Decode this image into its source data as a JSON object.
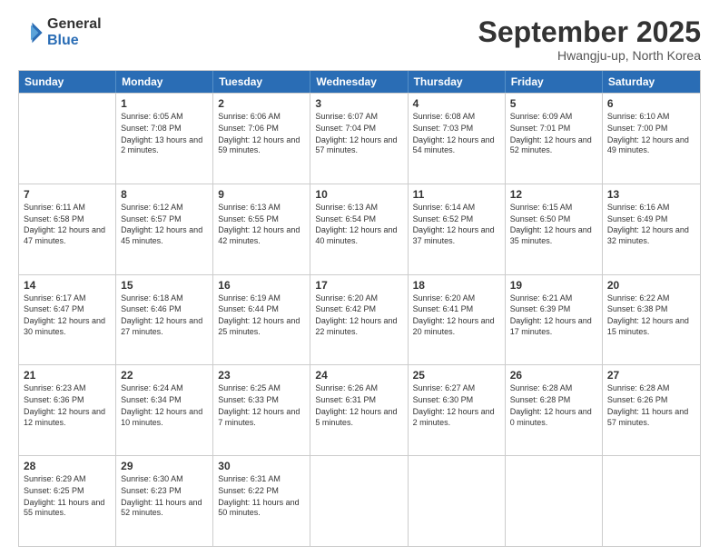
{
  "logo": {
    "general": "General",
    "blue": "Blue"
  },
  "title": "September 2025",
  "location": "Hwangju-up, North Korea",
  "header_days": [
    "Sunday",
    "Monday",
    "Tuesday",
    "Wednesday",
    "Thursday",
    "Friday",
    "Saturday"
  ],
  "rows": [
    [
      {
        "day": "",
        "sunrise": "",
        "sunset": "",
        "daylight": ""
      },
      {
        "day": "1",
        "sunrise": "Sunrise: 6:05 AM",
        "sunset": "Sunset: 7:08 PM",
        "daylight": "Daylight: 13 hours and 2 minutes."
      },
      {
        "day": "2",
        "sunrise": "Sunrise: 6:06 AM",
        "sunset": "Sunset: 7:06 PM",
        "daylight": "Daylight: 12 hours and 59 minutes."
      },
      {
        "day": "3",
        "sunrise": "Sunrise: 6:07 AM",
        "sunset": "Sunset: 7:04 PM",
        "daylight": "Daylight: 12 hours and 57 minutes."
      },
      {
        "day": "4",
        "sunrise": "Sunrise: 6:08 AM",
        "sunset": "Sunset: 7:03 PM",
        "daylight": "Daylight: 12 hours and 54 minutes."
      },
      {
        "day": "5",
        "sunrise": "Sunrise: 6:09 AM",
        "sunset": "Sunset: 7:01 PM",
        "daylight": "Daylight: 12 hours and 52 minutes."
      },
      {
        "day": "6",
        "sunrise": "Sunrise: 6:10 AM",
        "sunset": "Sunset: 7:00 PM",
        "daylight": "Daylight: 12 hours and 49 minutes."
      }
    ],
    [
      {
        "day": "7",
        "sunrise": "Sunrise: 6:11 AM",
        "sunset": "Sunset: 6:58 PM",
        "daylight": "Daylight: 12 hours and 47 minutes."
      },
      {
        "day": "8",
        "sunrise": "Sunrise: 6:12 AM",
        "sunset": "Sunset: 6:57 PM",
        "daylight": "Daylight: 12 hours and 45 minutes."
      },
      {
        "day": "9",
        "sunrise": "Sunrise: 6:13 AM",
        "sunset": "Sunset: 6:55 PM",
        "daylight": "Daylight: 12 hours and 42 minutes."
      },
      {
        "day": "10",
        "sunrise": "Sunrise: 6:13 AM",
        "sunset": "Sunset: 6:54 PM",
        "daylight": "Daylight: 12 hours and 40 minutes."
      },
      {
        "day": "11",
        "sunrise": "Sunrise: 6:14 AM",
        "sunset": "Sunset: 6:52 PM",
        "daylight": "Daylight: 12 hours and 37 minutes."
      },
      {
        "day": "12",
        "sunrise": "Sunrise: 6:15 AM",
        "sunset": "Sunset: 6:50 PM",
        "daylight": "Daylight: 12 hours and 35 minutes."
      },
      {
        "day": "13",
        "sunrise": "Sunrise: 6:16 AM",
        "sunset": "Sunset: 6:49 PM",
        "daylight": "Daylight: 12 hours and 32 minutes."
      }
    ],
    [
      {
        "day": "14",
        "sunrise": "Sunrise: 6:17 AM",
        "sunset": "Sunset: 6:47 PM",
        "daylight": "Daylight: 12 hours and 30 minutes."
      },
      {
        "day": "15",
        "sunrise": "Sunrise: 6:18 AM",
        "sunset": "Sunset: 6:46 PM",
        "daylight": "Daylight: 12 hours and 27 minutes."
      },
      {
        "day": "16",
        "sunrise": "Sunrise: 6:19 AM",
        "sunset": "Sunset: 6:44 PM",
        "daylight": "Daylight: 12 hours and 25 minutes."
      },
      {
        "day": "17",
        "sunrise": "Sunrise: 6:20 AM",
        "sunset": "Sunset: 6:42 PM",
        "daylight": "Daylight: 12 hours and 22 minutes."
      },
      {
        "day": "18",
        "sunrise": "Sunrise: 6:20 AM",
        "sunset": "Sunset: 6:41 PM",
        "daylight": "Daylight: 12 hours and 20 minutes."
      },
      {
        "day": "19",
        "sunrise": "Sunrise: 6:21 AM",
        "sunset": "Sunset: 6:39 PM",
        "daylight": "Daylight: 12 hours and 17 minutes."
      },
      {
        "day": "20",
        "sunrise": "Sunrise: 6:22 AM",
        "sunset": "Sunset: 6:38 PM",
        "daylight": "Daylight: 12 hours and 15 minutes."
      }
    ],
    [
      {
        "day": "21",
        "sunrise": "Sunrise: 6:23 AM",
        "sunset": "Sunset: 6:36 PM",
        "daylight": "Daylight: 12 hours and 12 minutes."
      },
      {
        "day": "22",
        "sunrise": "Sunrise: 6:24 AM",
        "sunset": "Sunset: 6:34 PM",
        "daylight": "Daylight: 12 hours and 10 minutes."
      },
      {
        "day": "23",
        "sunrise": "Sunrise: 6:25 AM",
        "sunset": "Sunset: 6:33 PM",
        "daylight": "Daylight: 12 hours and 7 minutes."
      },
      {
        "day": "24",
        "sunrise": "Sunrise: 6:26 AM",
        "sunset": "Sunset: 6:31 PM",
        "daylight": "Daylight: 12 hours and 5 minutes."
      },
      {
        "day": "25",
        "sunrise": "Sunrise: 6:27 AM",
        "sunset": "Sunset: 6:30 PM",
        "daylight": "Daylight: 12 hours and 2 minutes."
      },
      {
        "day": "26",
        "sunrise": "Sunrise: 6:28 AM",
        "sunset": "Sunset: 6:28 PM",
        "daylight": "Daylight: 12 hours and 0 minutes."
      },
      {
        "day": "27",
        "sunrise": "Sunrise: 6:28 AM",
        "sunset": "Sunset: 6:26 PM",
        "daylight": "Daylight: 11 hours and 57 minutes."
      }
    ],
    [
      {
        "day": "28",
        "sunrise": "Sunrise: 6:29 AM",
        "sunset": "Sunset: 6:25 PM",
        "daylight": "Daylight: 11 hours and 55 minutes."
      },
      {
        "day": "29",
        "sunrise": "Sunrise: 6:30 AM",
        "sunset": "Sunset: 6:23 PM",
        "daylight": "Daylight: 11 hours and 52 minutes."
      },
      {
        "day": "30",
        "sunrise": "Sunrise: 6:31 AM",
        "sunset": "Sunset: 6:22 PM",
        "daylight": "Daylight: 11 hours and 50 minutes."
      },
      {
        "day": "",
        "sunrise": "",
        "sunset": "",
        "daylight": ""
      },
      {
        "day": "",
        "sunrise": "",
        "sunset": "",
        "daylight": ""
      },
      {
        "day": "",
        "sunrise": "",
        "sunset": "",
        "daylight": ""
      },
      {
        "day": "",
        "sunrise": "",
        "sunset": "",
        "daylight": ""
      }
    ]
  ]
}
